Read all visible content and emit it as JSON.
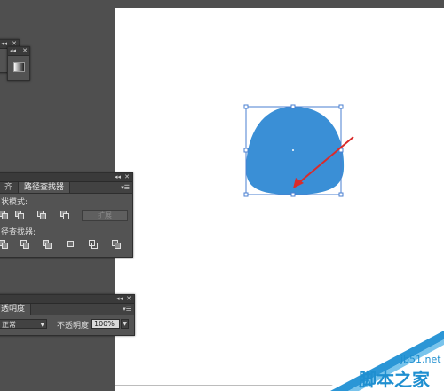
{
  "pathfinder": {
    "tabs": [
      "齐",
      "路径查找器"
    ],
    "shape_modes_label": "状模式:",
    "pathfinders_label": "径查找器:",
    "expand_label": "扩展"
  },
  "transparency": {
    "tab_label": "透明度",
    "blend_mode": "正常",
    "opacity_label": "不透明度",
    "opacity_value": "100%"
  },
  "watermark": {
    "site": "jb51.net",
    "name": "脚本之家"
  },
  "icons": {
    "panel_collapse": "double-chevron-icon",
    "panel_close": "close-icon",
    "panel_menu": "panel-menu-icon",
    "dropdown": "chevron-down-icon"
  },
  "colors": {
    "workspace": "#4f4f4f",
    "artboard": "#ffffff",
    "shape_fill": "#3a8fd6",
    "selection": "#4a7fd0",
    "arrow": "#d92b2b",
    "watermark": "#1f8fd0"
  }
}
